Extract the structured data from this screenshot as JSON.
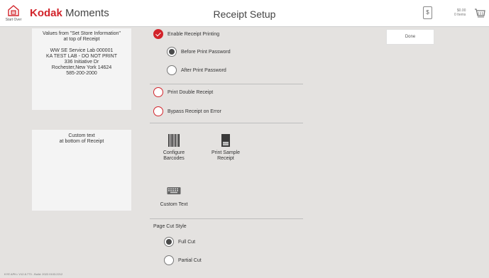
{
  "header": {
    "start_over_label": "Start Over",
    "brand_kodak": "Kodak",
    "brand_moments": "Moments",
    "page_title": "Receipt Setup",
    "cart_amount_symbol": "$",
    "cart_total": "$0.00",
    "cart_items": "0 Items"
  },
  "left_panels": {
    "top": {
      "line1": "Values from \"Set Store Information\"",
      "line2": "at top of Receipt",
      "address": [
        "WW SE Service Lab 000001",
        "KA TEST LAB - DO NOT PRINT",
        "336 Initiative Dr",
        "Rochester,New York 14624",
        "585-200-2000"
      ]
    },
    "bottom": {
      "line1": "Custom text",
      "line2": "at bottom of Receipt"
    }
  },
  "options": {
    "enable_receipt_printing": {
      "label": "Enable Receipt Printing",
      "checked": true
    },
    "before_print_password": {
      "label": "Before Print Password",
      "selected": true
    },
    "after_print_password": {
      "label": "After Print Password",
      "selected": false
    },
    "print_double_receipt": {
      "label": "Print Double Receipt",
      "checked": false
    },
    "bypass_receipt_on_error": {
      "label": "Bypass Receipt on Error",
      "checked": false
    }
  },
  "tools": {
    "configure_barcodes": [
      "Configure",
      "Barcodes"
    ],
    "print_sample_receipt": [
      "Print Sample",
      "Receipt"
    ],
    "custom_text": "Custom Text"
  },
  "page_cut": {
    "label": "Page Cut Style",
    "full_cut": {
      "label": "Full Cut",
      "selected": true
    },
    "partial_cut": {
      "label": "Partial Cut",
      "selected": false
    }
  },
  "done_label": "Done",
  "footer": "KYE APK= V12.8.773 - Build: 2022.0103.2212",
  "colors": {
    "accent_red": "#d2232a",
    "background": "#e4e2e0",
    "panel": "#f4f4f4"
  },
  "icons": [
    "home-icon",
    "dollar-icon",
    "cart-icon",
    "barcode-icon",
    "sample-receipt-icon",
    "keyboard-icon"
  ]
}
